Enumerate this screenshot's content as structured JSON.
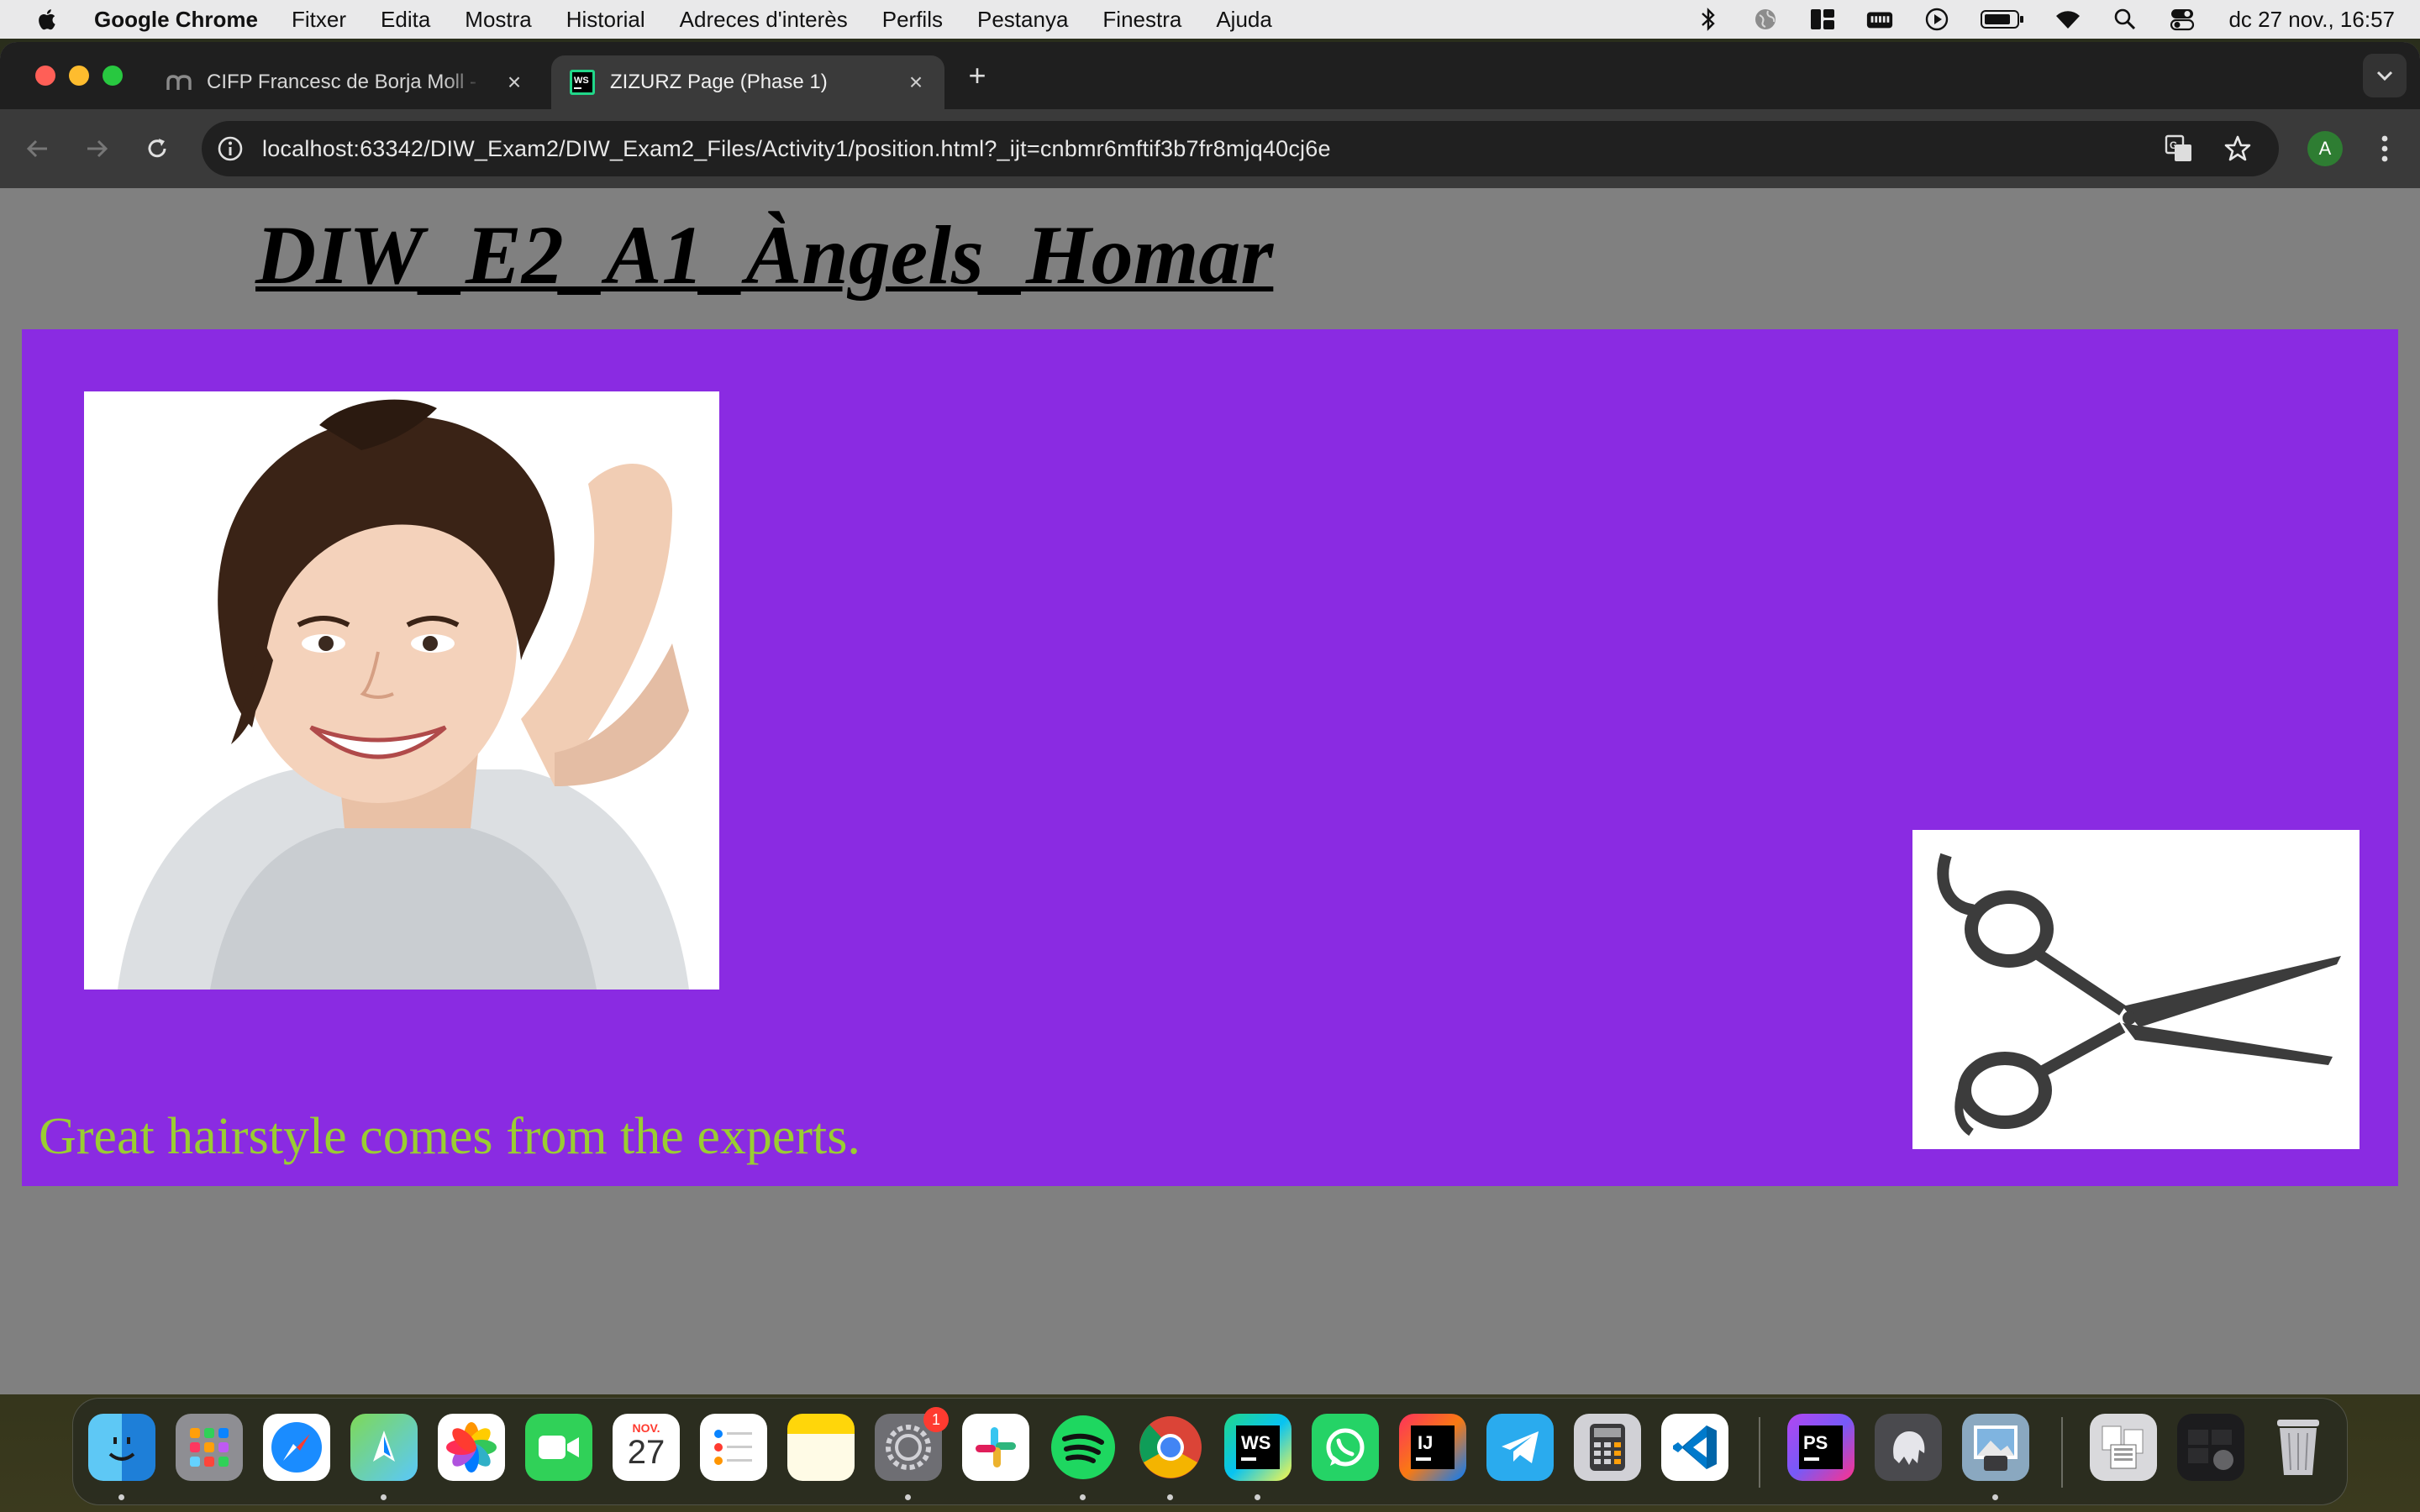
{
  "menubar": {
    "app_name": "Google Chrome",
    "items": [
      "Fitxer",
      "Edita",
      "Mostra",
      "Historial",
      "Adreces d'interès",
      "Perfils",
      "Pestanya",
      "Finestra",
      "Ajuda"
    ],
    "status_icons": [
      "bluetooth-icon",
      "vpn-globe-icon",
      "stage-manager-icon",
      "keyboard-icon",
      "play-icon",
      "battery-icon",
      "wifi-icon",
      "spotlight-search-icon",
      "control-center-icon"
    ],
    "clock": "dc 27 nov., 16:57"
  },
  "browser": {
    "tabs": [
      {
        "title": "CIFP Francesc de Borja Moll - ",
        "favicon": "moodle-icon",
        "active": false
      },
      {
        "title": "ZIZURZ Page (Phase 1)",
        "favicon": "webstorm-icon",
        "active": true
      }
    ],
    "url": "localhost:63342/DIW_Exam2/DIW_Exam2_Files/Activity1/position.html?_ijt=cnbmr6mftif3b7fr8mjq40cj6e",
    "profile_initial": "A"
  },
  "page": {
    "heading": "DIW_E2_A1_Àngels_Homar",
    "tagline": "Great hairstyle comes from the experts.",
    "colors": {
      "background": "#808080",
      "hero": "#8a2be2",
      "tagline": "#9acd32",
      "heading": "#000000"
    }
  },
  "dock": {
    "calendar": {
      "month": "NOV.",
      "day": "27"
    },
    "settings_badge": "1",
    "apps": [
      "Finder",
      "Launchpad",
      "Safari",
      "Maps",
      "Photos",
      "FaceTime",
      "Calendar",
      "Reminders",
      "Notes",
      "System Settings",
      "Slack",
      "Spotify",
      "Chrome",
      "WebStorm",
      "WhatsApp",
      "IntelliJ IDEA",
      "Telegram",
      "Calculator",
      "Visual Studio Code",
      "PhpStorm",
      "TablePlus",
      "Preview",
      "Downloads",
      "Recent",
      "Trash"
    ]
  }
}
